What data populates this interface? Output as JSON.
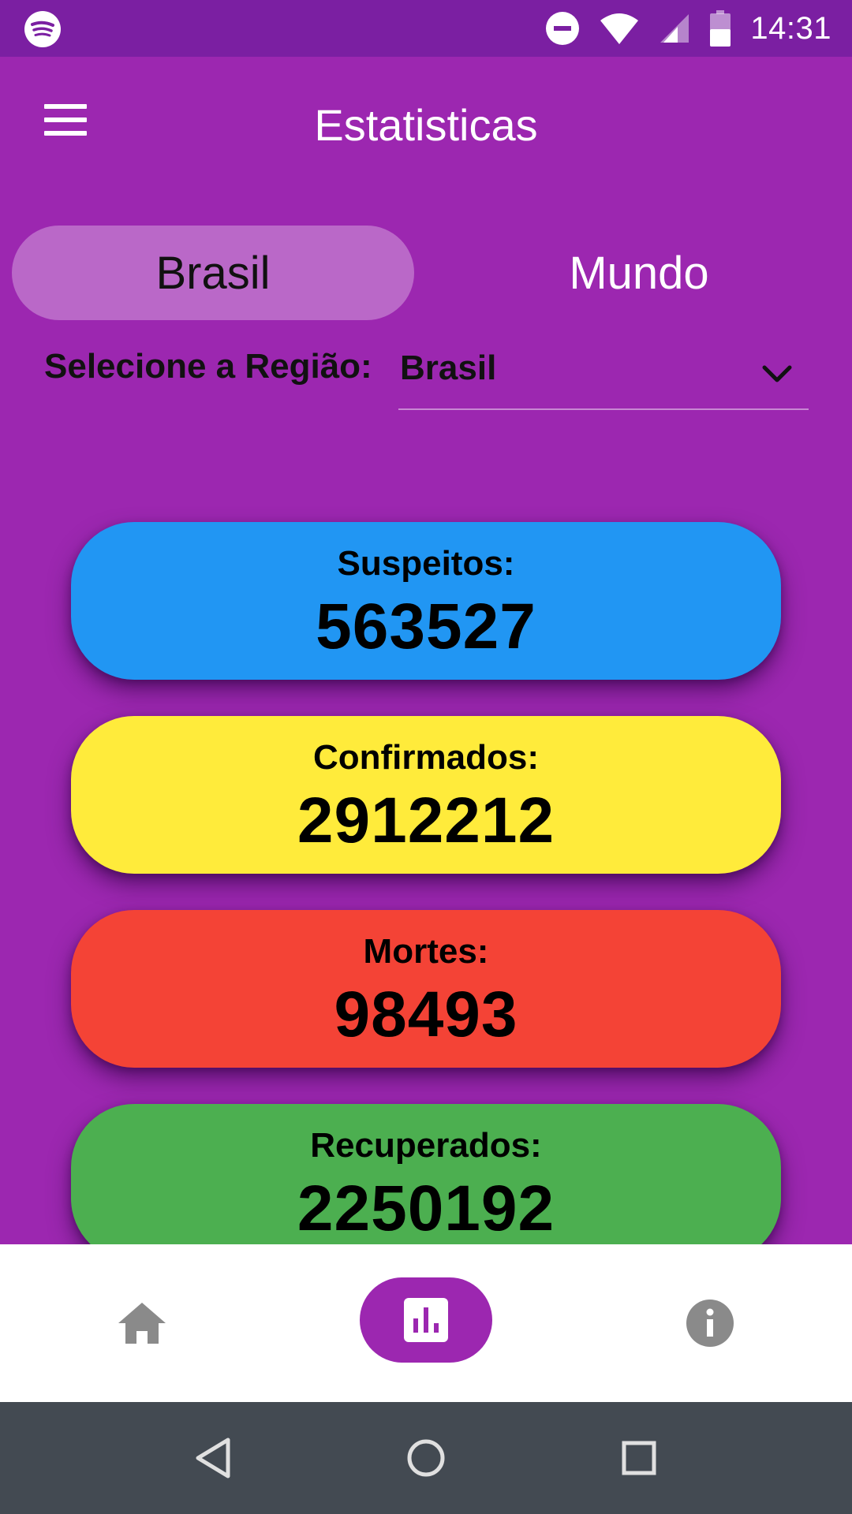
{
  "status_bar": {
    "time": "14:31",
    "icons": [
      "spotify-icon",
      "do-not-disturb-icon",
      "wifi-icon",
      "cell-signal-icon",
      "battery-icon"
    ]
  },
  "app_bar": {
    "title": "Estatisticas",
    "menu_icon": "menu-icon"
  },
  "tabs": [
    {
      "label": "Brasil",
      "active": true
    },
    {
      "label": "Mundo",
      "active": false
    }
  ],
  "region": {
    "label": "Selecione a Região:",
    "selected": "Brasil"
  },
  "stats": [
    {
      "label": "Suspeitos:",
      "value": "563527",
      "color": "#2196f3"
    },
    {
      "label": "Confirmados:",
      "value": "2912212",
      "color": "#ffeb3b"
    },
    {
      "label": "Mortes:",
      "value": "98493",
      "color": "#f44336"
    },
    {
      "label": "Recuperados:",
      "value": "2250192",
      "color": "#4caf50"
    }
  ],
  "bottom_nav": {
    "items": [
      "home-icon",
      "bar-chart-icon",
      "info-icon"
    ],
    "active_index": 1
  },
  "system_nav": [
    "back-icon",
    "home-circle-icon",
    "recents-icon"
  ],
  "colors": {
    "background": "#9c27b0",
    "status_bar": "#7b1fa2",
    "active_tab": "#ba68c8",
    "system_nav": "#434a52"
  }
}
